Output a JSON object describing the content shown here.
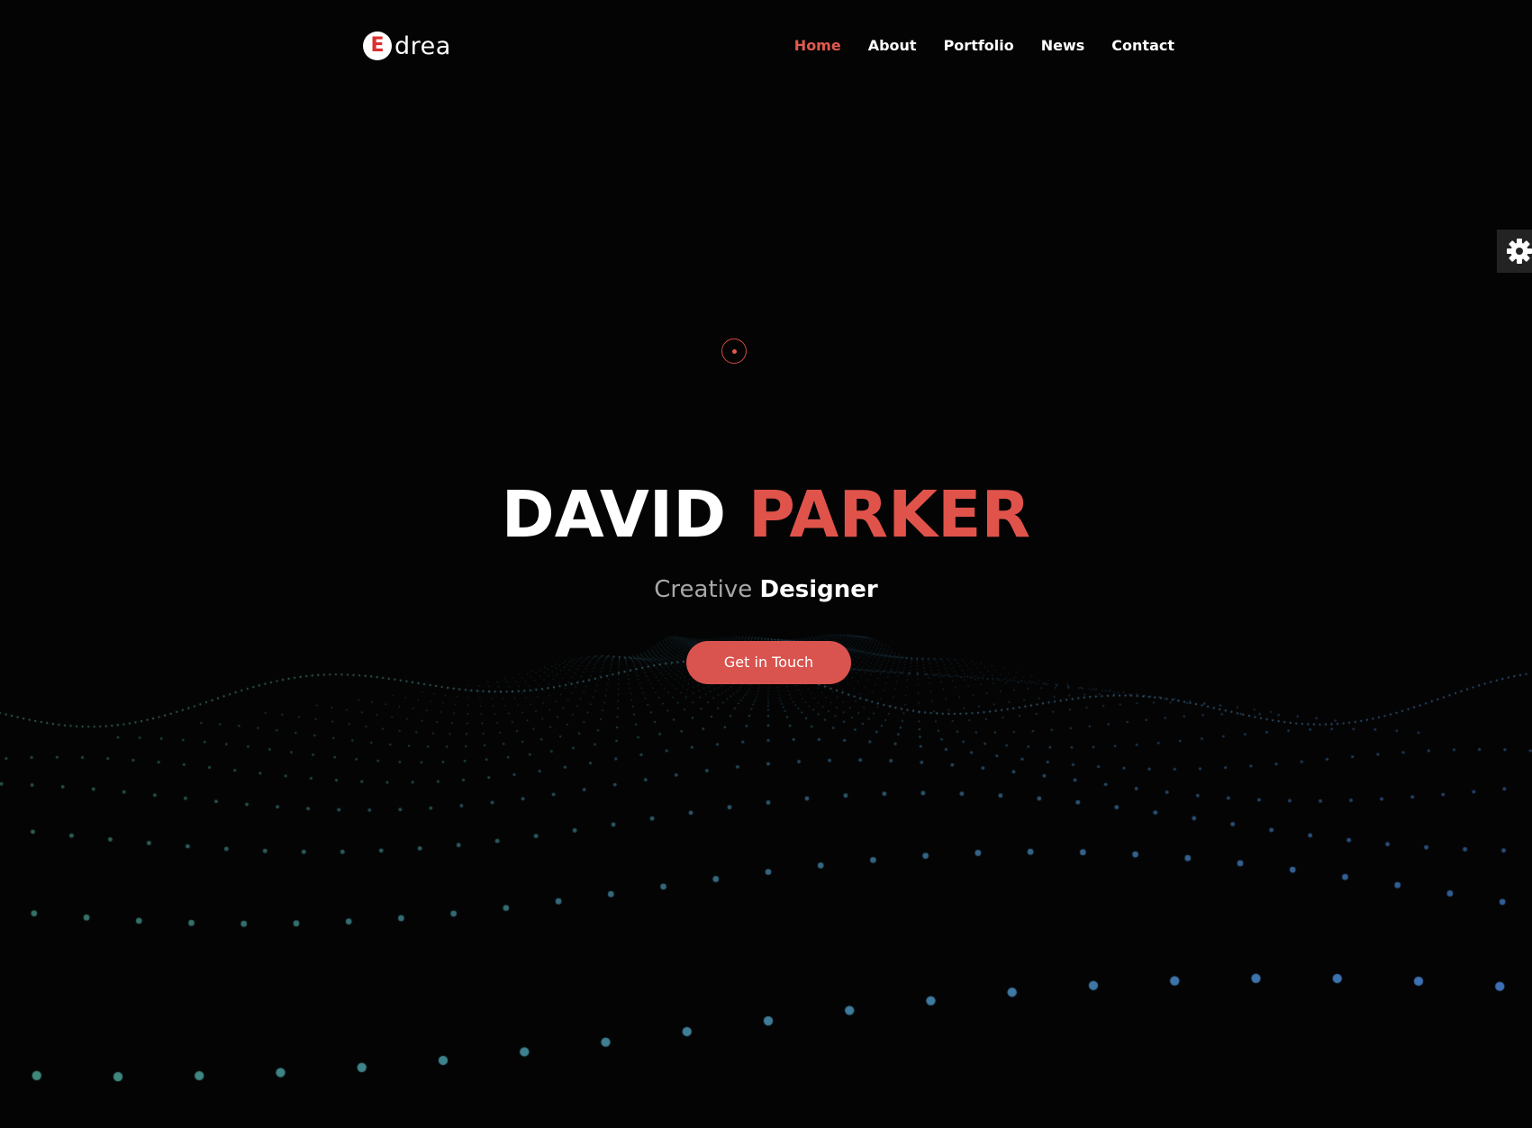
{
  "header": {
    "logo": {
      "badge_letter": "E",
      "text": "drea"
    },
    "nav": [
      {
        "label": "Home",
        "active": true
      },
      {
        "label": "About",
        "active": false
      },
      {
        "label": "Portfolio",
        "active": false
      },
      {
        "label": "News",
        "active": false
      },
      {
        "label": "Contact",
        "active": false
      }
    ]
  },
  "settings": {
    "icon": "gear-icon"
  },
  "hero": {
    "first_name": "DAVID",
    "last_name": "PARKER",
    "subtitle_light": "Creative",
    "subtitle_bold": "Designer",
    "cta_label": "Get in Touch"
  },
  "colors": {
    "background": "#040404",
    "accent": "#e0534b",
    "button": "#d9534f",
    "text": "#ffffff",
    "muted_text": "#a8a8a8",
    "particles_left": "#3f8a7a",
    "particles_right": "#3d6fb8"
  },
  "icons": {
    "scroll_indicator": "scroll-indicator-icon",
    "background": "particle-wave"
  }
}
